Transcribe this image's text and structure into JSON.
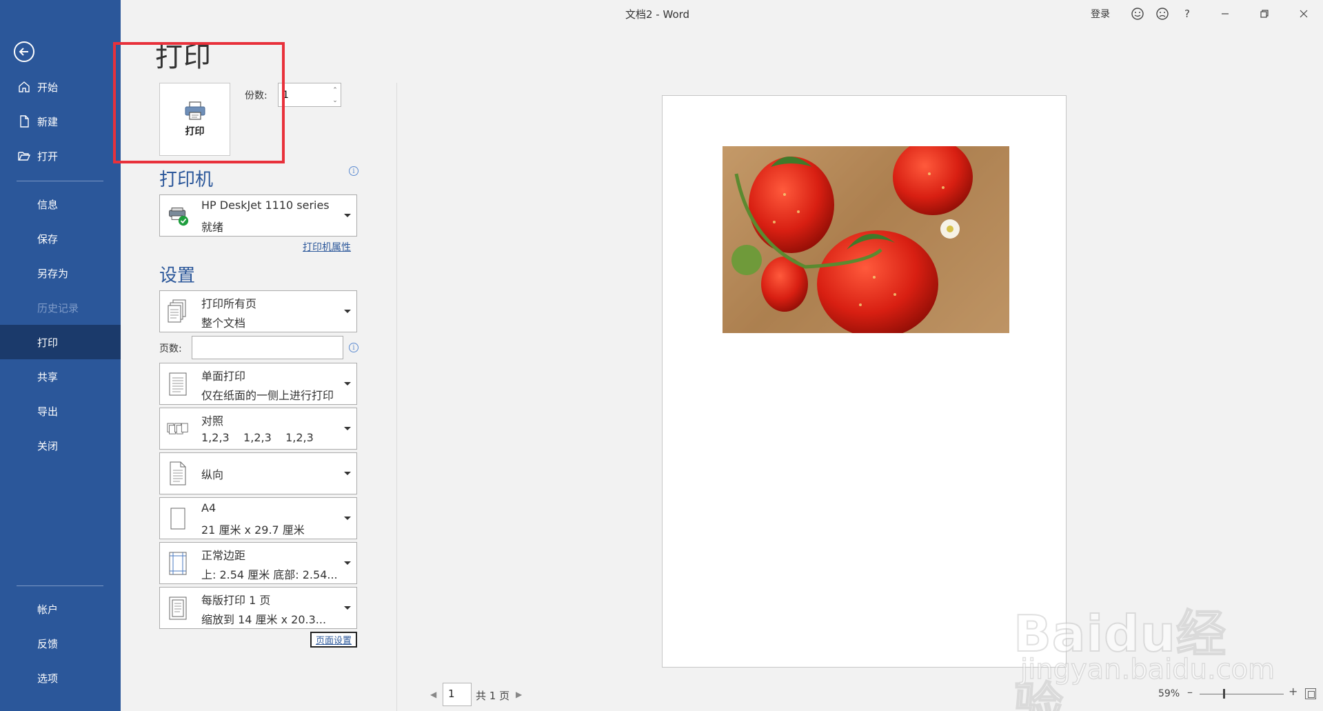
{
  "window": {
    "title": "文档2  -  Word",
    "login": "登录",
    "help": "?"
  },
  "sidebar": {
    "items": [
      {
        "label": "开始",
        "icon": "home-icon"
      },
      {
        "label": "新建",
        "icon": "new-doc-icon"
      },
      {
        "label": "打开",
        "icon": "open-folder-icon"
      },
      {
        "label": "信息"
      },
      {
        "label": "保存"
      },
      {
        "label": "另存为"
      },
      {
        "label": "历史记录",
        "disabled": true
      },
      {
        "label": "打印",
        "active": true
      },
      {
        "label": "共享"
      },
      {
        "label": "导出"
      },
      {
        "label": "关闭"
      },
      {
        "label": "帐户"
      },
      {
        "label": "反馈"
      },
      {
        "label": "选项"
      }
    ],
    "colors": {
      "background": "#2b579a",
      "active": "#1b3a6b"
    }
  },
  "print": {
    "title": "打印",
    "button_label": "打印",
    "copies_label": "份数:",
    "copies_value": "1"
  },
  "printer": {
    "heading": "打印机",
    "name": "HP DeskJet 1110 series",
    "status": "就绪",
    "properties_link": "打印机属性"
  },
  "settings": {
    "heading": "设置",
    "range": {
      "line1": "打印所有页",
      "line2": "整个文档"
    },
    "pages_label": "页数:",
    "pages_value": "",
    "sides": {
      "line1": "单面打印",
      "line2": "仅在纸面的一侧上进行打印"
    },
    "collate": {
      "line1": "对照",
      "line2": "1,2,3    1,2,3    1,2,3"
    },
    "orientation": {
      "line1": "纵向"
    },
    "paper": {
      "line1": "A4",
      "line2": "21 厘米 x 29.7 厘米"
    },
    "margins": {
      "line1": "正常边距",
      "line2": "上: 2.54 厘米 底部: 2.54..."
    },
    "per_sheet": {
      "line1": "每版打印 1 页",
      "line2": "缩放到 14 厘米 x 20.3..."
    },
    "page_setup_link": "页面设置"
  },
  "preview": {
    "current_page": "1",
    "total_pages": "共 1 页",
    "zoom": "59%",
    "zoom_fraction": 0.29
  },
  "watermark": {
    "main": "Baidu经验",
    "sub": "jingyan.baidu.com"
  },
  "colors": {
    "accent": "#2b579a",
    "highlight_box": "#e8313b"
  }
}
